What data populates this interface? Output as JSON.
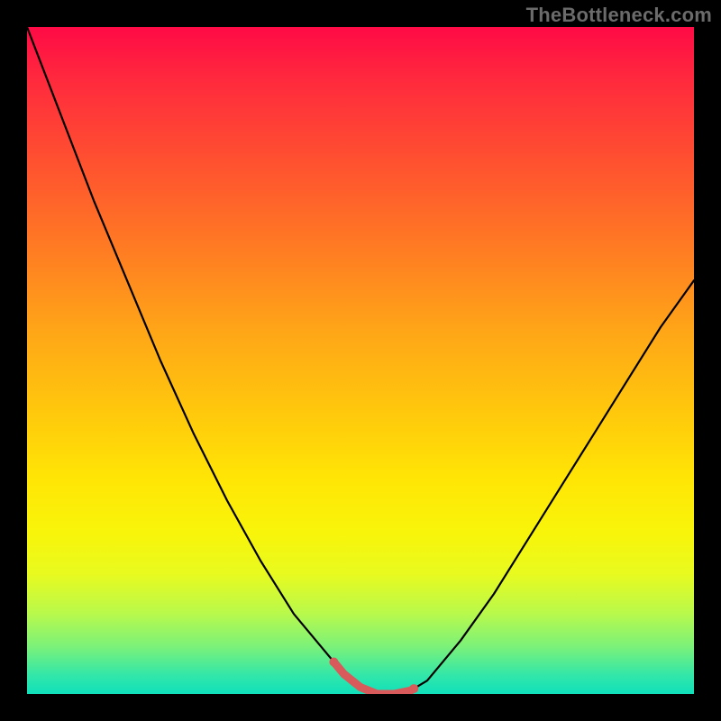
{
  "watermark": "TheBottleneck.com",
  "chart_data": {
    "type": "line",
    "title": "",
    "xlabel": "",
    "ylabel": "",
    "x": [
      0.0,
      0.05,
      0.1,
      0.15,
      0.2,
      0.25,
      0.3,
      0.35,
      0.4,
      0.45,
      0.475,
      0.5,
      0.525,
      0.55,
      0.575,
      0.6,
      0.65,
      0.7,
      0.75,
      0.8,
      0.85,
      0.9,
      0.95,
      1.0
    ],
    "values": [
      1.0,
      0.87,
      0.74,
      0.62,
      0.5,
      0.39,
      0.29,
      0.2,
      0.12,
      0.06,
      0.03,
      0.01,
      0.0,
      0.0,
      0.005,
      0.02,
      0.08,
      0.15,
      0.23,
      0.31,
      0.39,
      0.47,
      0.55,
      0.62
    ],
    "series": [
      {
        "name": "bottleneck-curve",
        "description": "V-shaped curve (black) with small red highlight at trough between x≈0.46 and x≈0.58"
      }
    ],
    "xlim": [
      0.0,
      1.0
    ],
    "ylim": [
      0.0,
      1.0
    ],
    "grid": false,
    "background": "vertical rainbow gradient red→green",
    "border": "black frame"
  },
  "highlight": {
    "start_x": 0.46,
    "end_x": 0.58,
    "color": "#d85a5a"
  }
}
